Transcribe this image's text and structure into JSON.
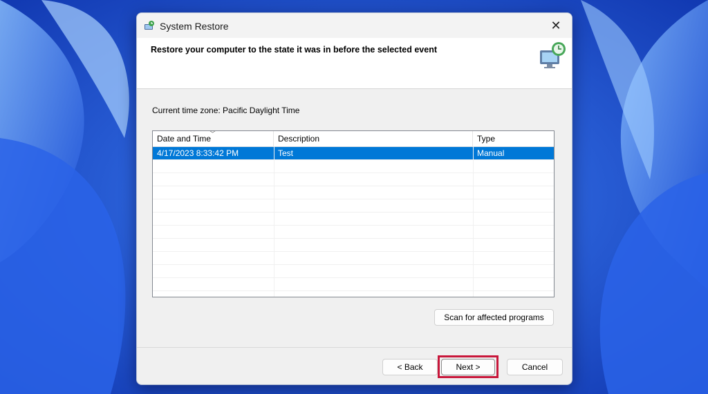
{
  "window": {
    "title": "System Restore",
    "close_symbol": "✕"
  },
  "header": {
    "instruction": "Restore your computer to the state it was in before the selected event"
  },
  "timezone_label": "Current time zone: Pacific Daylight Time",
  "restore_points": {
    "columns": [
      "Date and Time",
      "Description",
      "Type"
    ],
    "rows": [
      {
        "date_time": "4/17/2023 8:33:42 PM",
        "description": "Test",
        "type": "Manual",
        "selected": true
      }
    ]
  },
  "buttons": {
    "scan": "Scan for affected programs",
    "back": "< Back",
    "next": "Next >",
    "cancel": "Cancel"
  },
  "colors": {
    "selection": "#0078d7",
    "highlight_box": "#c8173b",
    "wallpaper": "#1c4fd6"
  }
}
